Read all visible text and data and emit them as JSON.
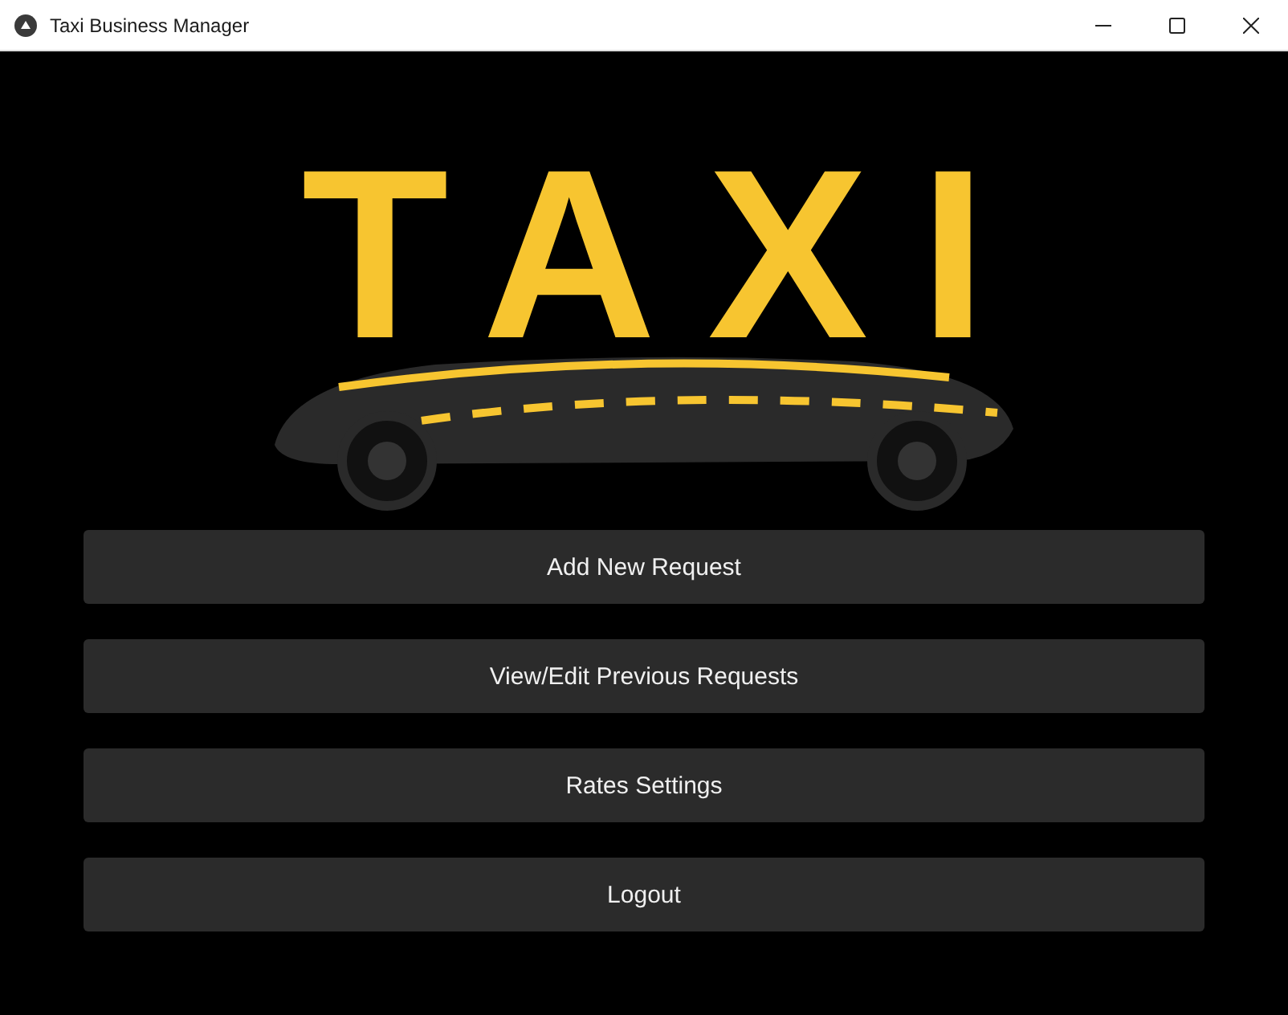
{
  "window": {
    "title": "Taxi Business Manager"
  },
  "logo": {
    "text": "TAXI"
  },
  "buttons": [
    {
      "label": "Add New Request"
    },
    {
      "label": "View/Edit Previous Requests"
    },
    {
      "label": "Rates Settings"
    },
    {
      "label": "Logout"
    }
  ]
}
